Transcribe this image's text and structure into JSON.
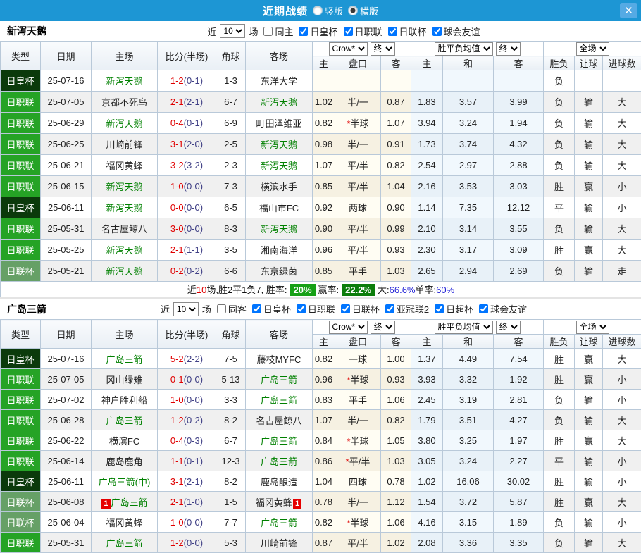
{
  "colors": {
    "titlebar_blue": "#1d96d4",
    "close_button_blue": "#55aae4",
    "cup_badge_green": "#0b3a0b",
    "league_badge_green": "#25a325",
    "league_cup_badge_green": "#66a066",
    "win_red": "#d90000",
    "lose_green": "#008000",
    "draw_blue": "#1515cc",
    "score_red": "#e00000",
    "halftime_navy": "#3f3f85",
    "rate_box_green": "#16a016"
  },
  "titlebar": {
    "title": "近期战绩",
    "layout_vertical": "竖版",
    "layout_horizontal": "横版",
    "close_glyph": "✕"
  },
  "labels": {
    "near": "近",
    "games": "场"
  },
  "main_headers": [
    "类型",
    "日期",
    "主场",
    "比分(半场)",
    "角球",
    "客场"
  ],
  "subheaders": [
    "主",
    "盘口",
    "客",
    "主",
    "和",
    "客",
    "胜负",
    "让球",
    "进球数"
  ],
  "dropdowns": {
    "company": "Crow*",
    "final1": "终",
    "mean": "胜平负均值",
    "final2": "终",
    "scope": "全场"
  },
  "sections": [
    {
      "team": "新泻天鹅",
      "games": "10",
      "same": "同主",
      "leagues": [
        "日皇杯",
        "日职联",
        "日联杯",
        "球会友谊"
      ],
      "rows": [
        {
          "type": "日皇杯",
          "tc": "cup",
          "date": "25-07-16",
          "home": "新泻天鹅",
          "hf": true,
          "hb": "",
          "ft": "1-2",
          "ht": "(0-1)",
          "corner": "1-3",
          "away": "东洋大学",
          "af": false,
          "ab": "",
          "oh": "",
          "ps": "",
          "pan": "",
          "oa": "",
          "mh": "",
          "md": "",
          "ma": "",
          "res": "负",
          "resc": "g",
          "let": "",
          "letc": "",
          "goal": "",
          "goalc": ""
        },
        {
          "type": "日职联",
          "tc": "league",
          "date": "25-07-05",
          "home": "京都不死鸟",
          "hf": false,
          "hb": "",
          "ft": "2-1",
          "ht": "(2-1)",
          "corner": "6-7",
          "away": "新泻天鹅",
          "af": true,
          "ab": "",
          "oh": "1.02",
          "ps": "",
          "pan": "半/一",
          "oa": "0.87",
          "mh": "1.83",
          "md": "3.57",
          "ma": "3.99",
          "res": "负",
          "resc": "g",
          "let": "输",
          "letc": "g",
          "goal": "大",
          "goalc": "r"
        },
        {
          "type": "日职联",
          "tc": "league",
          "date": "25-06-29",
          "home": "新泻天鹅",
          "hf": true,
          "hb": "",
          "ft": "0-4",
          "ht": "(0-1)",
          "corner": "6-9",
          "away": "町田泽维亚",
          "af": false,
          "ab": "",
          "oh": "0.82",
          "ps": "*",
          "pan": "半球",
          "oa": "1.07",
          "mh": "3.94",
          "md": "3.24",
          "ma": "1.94",
          "res": "负",
          "resc": "g",
          "let": "输",
          "letc": "g",
          "goal": "大",
          "goalc": "r"
        },
        {
          "type": "日职联",
          "tc": "league",
          "date": "25-06-25",
          "home": "川崎前锋",
          "hf": false,
          "hb": "",
          "ft": "3-1",
          "ht": "(2-0)",
          "corner": "2-5",
          "away": "新泻天鹅",
          "af": true,
          "ab": "",
          "oh": "0.98",
          "ps": "",
          "pan": "半/一",
          "oa": "0.91",
          "mh": "1.73",
          "md": "3.74",
          "ma": "4.32",
          "res": "负",
          "resc": "g",
          "let": "输",
          "letc": "g",
          "goal": "大",
          "goalc": "r"
        },
        {
          "type": "日职联",
          "tc": "league",
          "date": "25-06-21",
          "home": "福冈黄蜂",
          "hf": false,
          "hb": "",
          "ft": "3-2",
          "ht": "(3-2)",
          "corner": "2-3",
          "away": "新泻天鹅",
          "af": true,
          "ab": "",
          "oh": "1.07",
          "ps": "",
          "pan": "平/半",
          "oa": "0.82",
          "mh": "2.54",
          "md": "2.97",
          "ma": "2.88",
          "res": "负",
          "resc": "g",
          "let": "输",
          "letc": "g",
          "goal": "大",
          "goalc": "r"
        },
        {
          "type": "日职联",
          "tc": "league",
          "date": "25-06-15",
          "home": "新泻天鹅",
          "hf": true,
          "hb": "",
          "ft": "1-0",
          "ht": "(0-0)",
          "corner": "7-3",
          "away": "横滨水手",
          "af": false,
          "ab": "",
          "oh": "0.85",
          "ps": "",
          "pan": "平/半",
          "oa": "1.04",
          "mh": "2.16",
          "md": "3.53",
          "ma": "3.03",
          "res": "胜",
          "resc": "r",
          "let": "赢",
          "letc": "r",
          "goal": "小",
          "goalc": "g"
        },
        {
          "type": "日皇杯",
          "tc": "cup",
          "date": "25-06-11",
          "home": "新泻天鹅",
          "hf": true,
          "hb": "",
          "ft": "0-0",
          "ht": "(0-0)",
          "corner": "6-5",
          "away": "福山市FC",
          "af": false,
          "ab": "",
          "oh": "0.92",
          "ps": "",
          "pan": "两球",
          "oa": "0.90",
          "mh": "1.14",
          "md": "7.35",
          "ma": "12.12",
          "res": "平",
          "resc": "b",
          "let": "输",
          "letc": "g",
          "goal": "小",
          "goalc": "g"
        },
        {
          "type": "日职联",
          "tc": "league",
          "date": "25-05-31",
          "home": "名古屋鲸八",
          "hf": false,
          "hb": "",
          "ft": "3-0",
          "ht": "(0-0)",
          "corner": "8-3",
          "away": "新泻天鹅",
          "af": true,
          "ab": "",
          "oh": "0.90",
          "ps": "",
          "pan": "平/半",
          "oa": "0.99",
          "mh": "2.10",
          "md": "3.14",
          "ma": "3.55",
          "res": "负",
          "resc": "g",
          "let": "输",
          "letc": "g",
          "goal": "大",
          "goalc": "r"
        },
        {
          "type": "日职联",
          "tc": "league",
          "date": "25-05-25",
          "home": "新泻天鹅",
          "hf": true,
          "hb": "",
          "ft": "2-1",
          "ht": "(1-1)",
          "corner": "3-5",
          "away": "湘南海洋",
          "af": false,
          "ab": "",
          "oh": "0.96",
          "ps": "",
          "pan": "平/半",
          "oa": "0.93",
          "mh": "2.30",
          "md": "3.17",
          "ma": "3.09",
          "res": "胜",
          "resc": "r",
          "let": "赢",
          "letc": "r",
          "goal": "大",
          "goalc": "r"
        },
        {
          "type": "日联杯",
          "tc": "lcup",
          "date": "25-05-21",
          "home": "新泻天鹅",
          "hf": true,
          "hb": "",
          "ft": "0-2",
          "ht": "(0-2)",
          "corner": "6-6",
          "away": "东京绿茵",
          "af": false,
          "ab": "",
          "oh": "0.85",
          "ps": "",
          "pan": "平手",
          "oa": "1.03",
          "mh": "2.65",
          "md": "2.94",
          "ma": "2.69",
          "res": "负",
          "resc": "g",
          "let": "输",
          "letc": "g",
          "goal": "走",
          "goalc": "b"
        }
      ],
      "summary": {
        "s1": "近",
        "count": "10",
        "s2": "场,胜2平1负7, 胜率:",
        "win_rate": "20%",
        "s3": "赢率:",
        "profit_rate": "22.2%",
        "s4": "大:",
        "big_rate": "66.6%",
        "s5": "单率:",
        "single_rate": "60%"
      }
    },
    {
      "team": "广岛三箭",
      "games": "10",
      "same": "同客",
      "leagues": [
        "日皇杯",
        "日职联",
        "日联杯",
        "亚冠联2",
        "日超杯",
        "球会友谊"
      ],
      "rows": [
        {
          "type": "日皇杯",
          "tc": "cup",
          "date": "25-07-16",
          "home": "广岛三箭",
          "hf": true,
          "hb": "",
          "ft": "5-2",
          "ht": "(2-2)",
          "corner": "7-5",
          "away": "藤枝MYFC",
          "af": false,
          "ab": "",
          "oh": "0.82",
          "ps": "",
          "pan": "一球",
          "oa": "1.00",
          "mh": "1.37",
          "md": "4.49",
          "ma": "7.54",
          "res": "胜",
          "resc": "r",
          "let": "赢",
          "letc": "r",
          "goal": "大",
          "goalc": "r"
        },
        {
          "type": "日职联",
          "tc": "league",
          "date": "25-07-05",
          "home": "冈山绿雉",
          "hf": false,
          "hb": "",
          "ft": "0-1",
          "ht": "(0-0)",
          "corner": "5-13",
          "away": "广岛三箭",
          "af": true,
          "ab": "",
          "oh": "0.96",
          "ps": "*",
          "pan": "半球",
          "oa": "0.93",
          "mh": "3.93",
          "md": "3.32",
          "ma": "1.92",
          "res": "胜",
          "resc": "r",
          "let": "赢",
          "letc": "r",
          "goal": "小",
          "goalc": "g"
        },
        {
          "type": "日职联",
          "tc": "league",
          "date": "25-07-02",
          "home": "神户胜利船",
          "hf": false,
          "hb": "",
          "ft": "1-0",
          "ht": "(0-0)",
          "corner": "3-3",
          "away": "广岛三箭",
          "af": true,
          "ab": "",
          "oh": "0.83",
          "ps": "",
          "pan": "平手",
          "oa": "1.06",
          "mh": "2.45",
          "md": "3.19",
          "ma": "2.81",
          "res": "负",
          "resc": "g",
          "let": "输",
          "letc": "g",
          "goal": "小",
          "goalc": "g"
        },
        {
          "type": "日职联",
          "tc": "league",
          "date": "25-06-28",
          "home": "广岛三箭",
          "hf": true,
          "hb": "",
          "ft": "1-2",
          "ht": "(0-2)",
          "corner": "8-2",
          "away": "名古屋鲸八",
          "af": false,
          "ab": "",
          "oh": "1.07",
          "ps": "",
          "pan": "半/一",
          "oa": "0.82",
          "mh": "1.79",
          "md": "3.51",
          "ma": "4.27",
          "res": "负",
          "resc": "g",
          "let": "输",
          "letc": "g",
          "goal": "大",
          "goalc": "r"
        },
        {
          "type": "日职联",
          "tc": "league",
          "date": "25-06-22",
          "home": "横滨FC",
          "hf": false,
          "hb": "",
          "ft": "0-4",
          "ht": "(0-3)",
          "corner": "6-7",
          "away": "广岛三箭",
          "af": true,
          "ab": "",
          "oh": "0.84",
          "ps": "*",
          "pan": "半球",
          "oa": "1.05",
          "mh": "3.80",
          "md": "3.25",
          "ma": "1.97",
          "res": "胜",
          "resc": "r",
          "let": "赢",
          "letc": "r",
          "goal": "大",
          "goalc": "r"
        },
        {
          "type": "日职联",
          "tc": "league",
          "date": "25-06-14",
          "home": "鹿岛鹿角",
          "hf": false,
          "hb": "",
          "ft": "1-1",
          "ht": "(0-1)",
          "corner": "12-3",
          "away": "广岛三箭",
          "af": true,
          "ab": "",
          "oh": "0.86",
          "ps": "*",
          "pan": "平/半",
          "oa": "1.03",
          "mh": "3.05",
          "md": "3.24",
          "ma": "2.27",
          "res": "平",
          "resc": "b",
          "let": "输",
          "letc": "g",
          "goal": "小",
          "goalc": "g"
        },
        {
          "type": "日皇杯",
          "tc": "cup",
          "date": "25-06-11",
          "home": "广岛三箭(中)",
          "hf": true,
          "hb": "",
          "ft": "3-1",
          "ht": "(2-1)",
          "corner": "8-2",
          "away": "鹿岛酿造",
          "af": false,
          "ab": "",
          "oh": "1.04",
          "ps": "",
          "pan": "四球",
          "oa": "0.78",
          "mh": "1.02",
          "md": "16.06",
          "ma": "30.02",
          "res": "胜",
          "resc": "r",
          "let": "输",
          "letc": "g",
          "goal": "小",
          "goalc": "g"
        },
        {
          "type": "日联杯",
          "tc": "lcup",
          "date": "25-06-08",
          "home": "广岛三箭",
          "hf": true,
          "hb": "1",
          "ft": "2-1",
          "ht": "(1-0)",
          "corner": "1-5",
          "away": "福冈黄蜂",
          "af": false,
          "ab": "1",
          "oh": "0.78",
          "ps": "",
          "pan": "半/一",
          "oa": "1.12",
          "mh": "1.54",
          "md": "3.72",
          "ma": "5.87",
          "res": "胜",
          "resc": "r",
          "let": "赢",
          "letc": "r",
          "goal": "大",
          "goalc": "r"
        },
        {
          "type": "日联杯",
          "tc": "lcup",
          "date": "25-06-04",
          "home": "福冈黄蜂",
          "hf": false,
          "hb": "",
          "ft": "1-0",
          "ht": "(0-0)",
          "corner": "7-7",
          "away": "广岛三箭",
          "af": true,
          "ab": "",
          "oh": "0.82",
          "ps": "*",
          "pan": "半球",
          "oa": "1.06",
          "mh": "4.16",
          "md": "3.15",
          "ma": "1.89",
          "res": "负",
          "resc": "g",
          "let": "输",
          "letc": "g",
          "goal": "小",
          "goalc": "g"
        },
        {
          "type": "日职联",
          "tc": "league",
          "date": "25-05-31",
          "home": "广岛三箭",
          "hf": true,
          "hb": "",
          "ft": "1-2",
          "ht": "(0-0)",
          "corner": "5-3",
          "away": "川崎前锋",
          "af": false,
          "ab": "",
          "oh": "0.87",
          "ps": "",
          "pan": "平/半",
          "oa": "1.02",
          "mh": "2.08",
          "md": "3.36",
          "ma": "3.35",
          "res": "负",
          "resc": "g",
          "let": "输",
          "letc": "g",
          "goal": "大",
          "goalc": "r"
        }
      ]
    }
  ]
}
